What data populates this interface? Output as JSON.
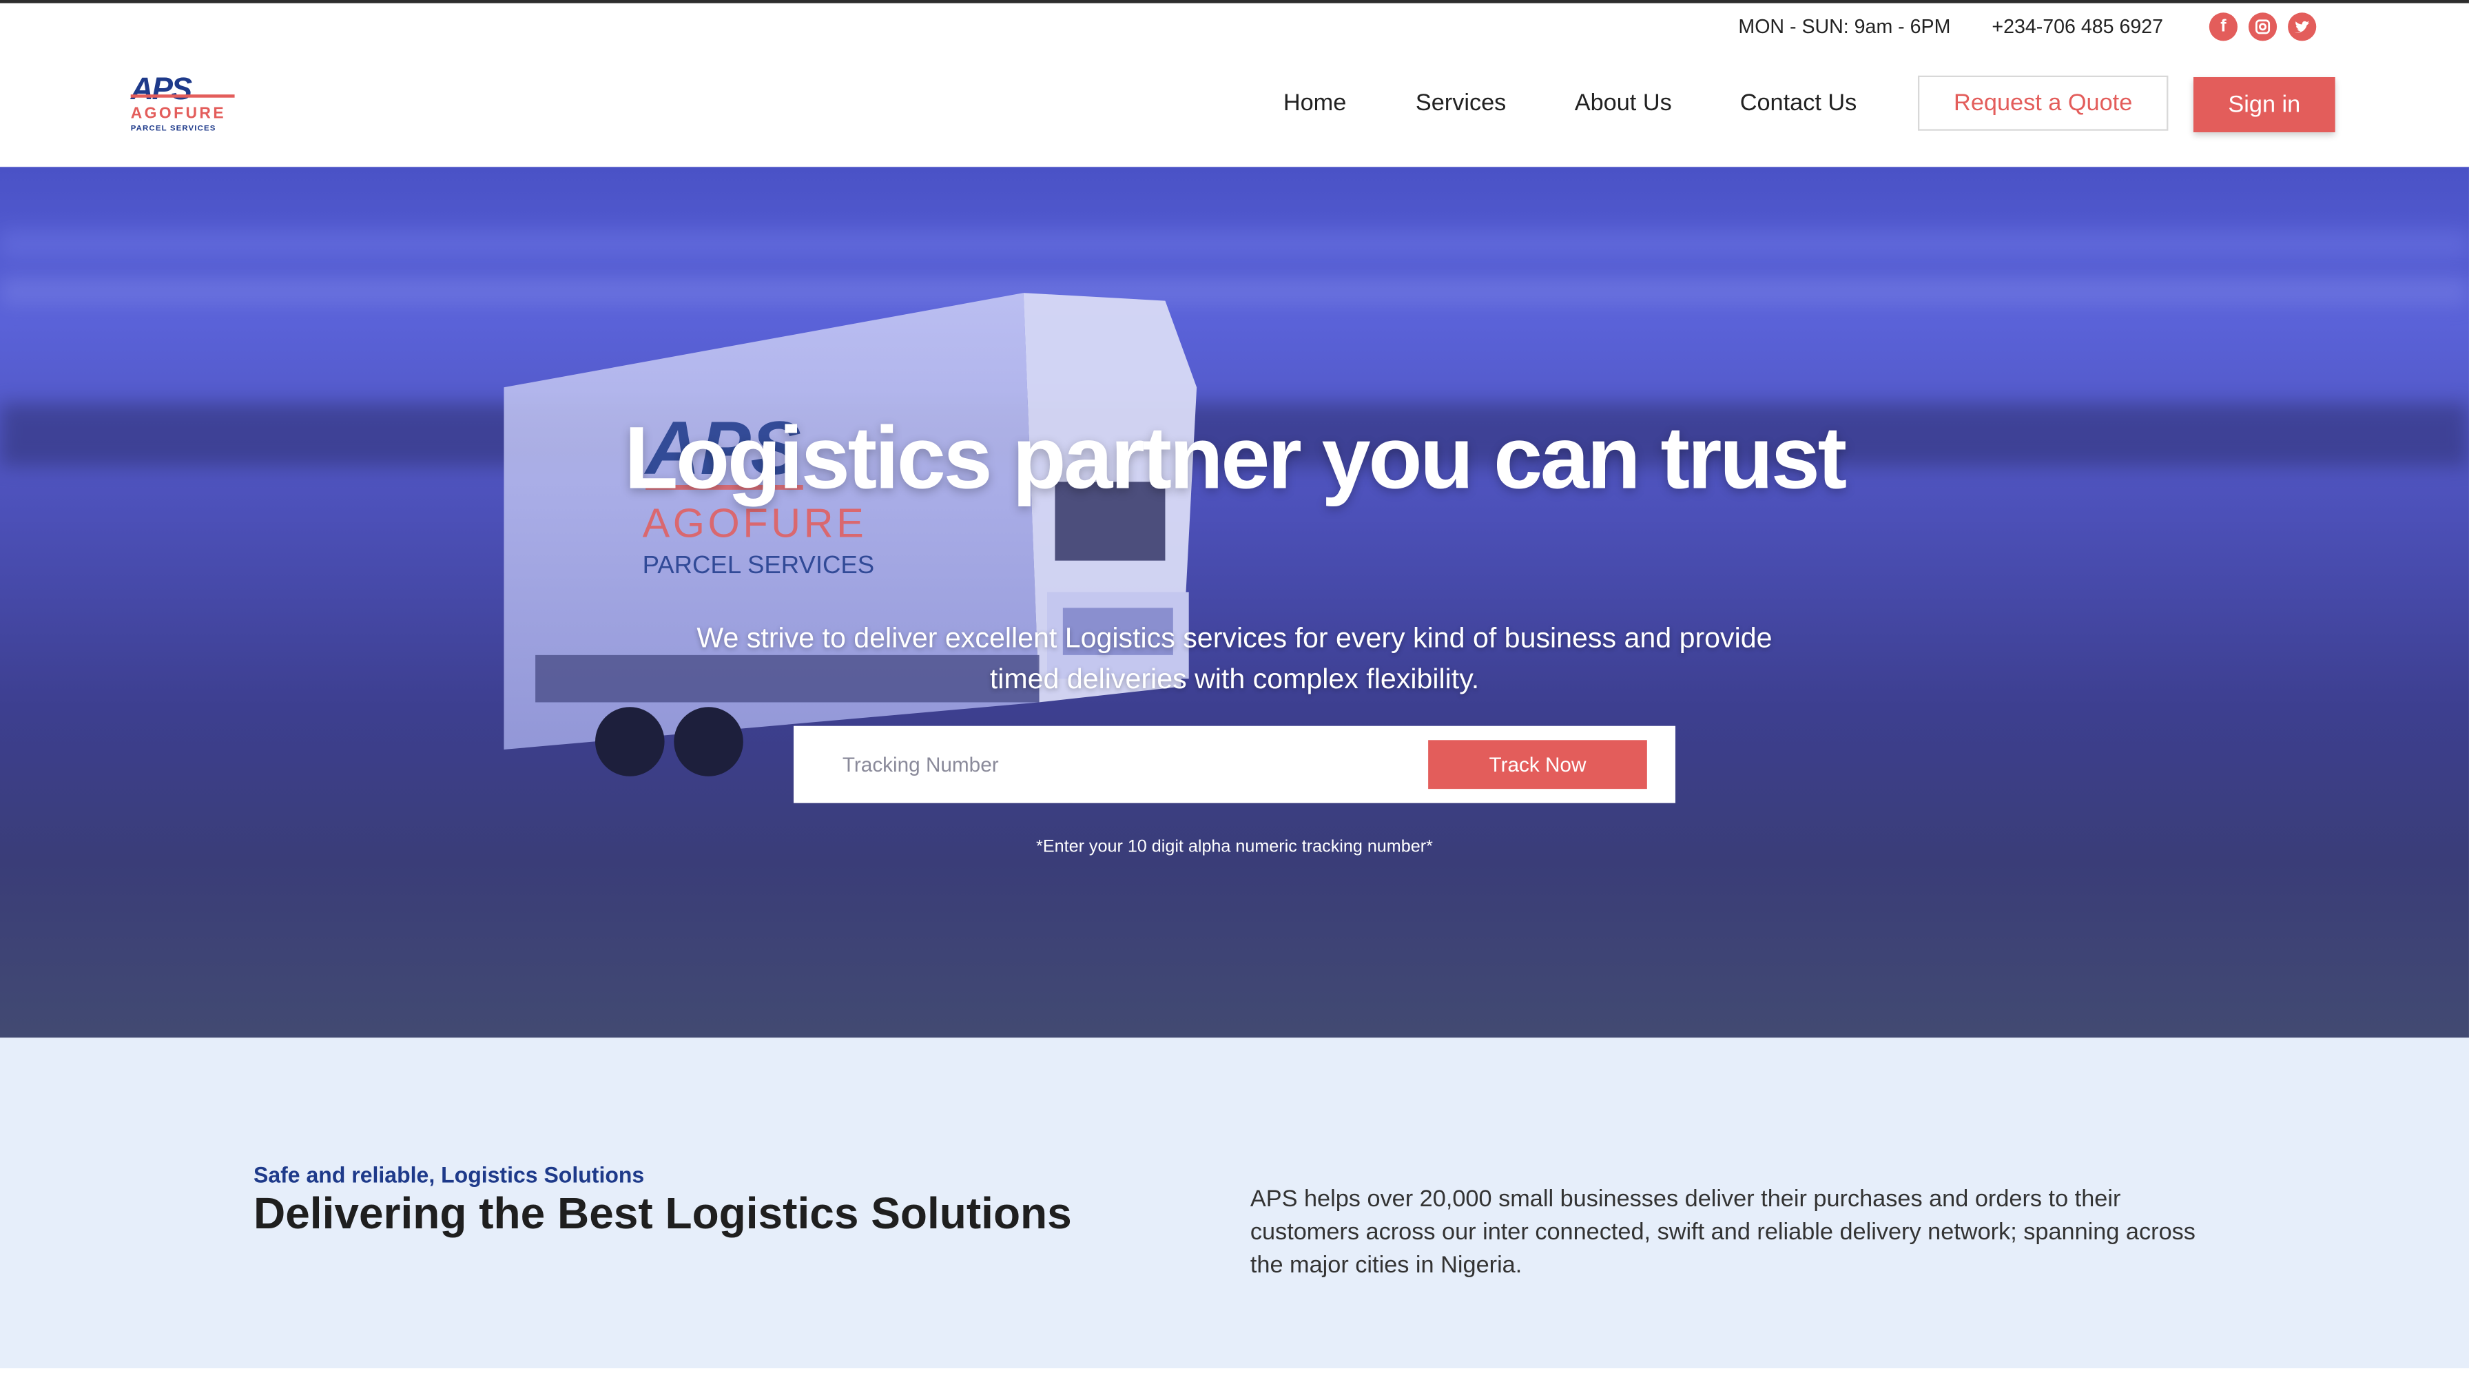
{
  "colors": {
    "accent": "#e35d5b",
    "brand_navy": "#1e3a8a",
    "section_bg": "#e6eefa",
    "hero_tint": "#4c50b8"
  },
  "topbar": {
    "hours": "MON - SUN: 9am - 6PM",
    "phone": "+234-706 485 6927",
    "social": [
      "facebook-icon",
      "instagram-icon",
      "twitter-icon"
    ]
  },
  "logo": {
    "mark": "APS",
    "name": "AGOFURE",
    "tagline": "PARCEL SERVICES"
  },
  "nav": {
    "home": "Home",
    "services": "Services",
    "about": "About Us",
    "contact": "Contact Us",
    "quote": "Request a Quote",
    "signin": "Sign in"
  },
  "hero": {
    "title": "Logistics partner you can trust",
    "subtitle": "We strive to deliver excellent Logistics services for every kind of business and provide timed deliveries with complex flexibility.",
    "tracking_placeholder": "Tracking Number",
    "track_button": "Track Now",
    "hint": "*Enter your 10 digit alpha numeric tracking number*",
    "truck_mark": "APS",
    "truck_name": "AGOFURE",
    "truck_tagline": "PARCEL SERVICES"
  },
  "about": {
    "kicker": "Safe and reliable, Logistics Solutions",
    "heading": "Delivering the Best Logistics Solutions",
    "paragraph": "APS helps over 20,000 small businesses deliver their purchases and orders to their customers across our inter connected, swift and reliable delivery network; spanning across the major cities in Nigeria."
  }
}
